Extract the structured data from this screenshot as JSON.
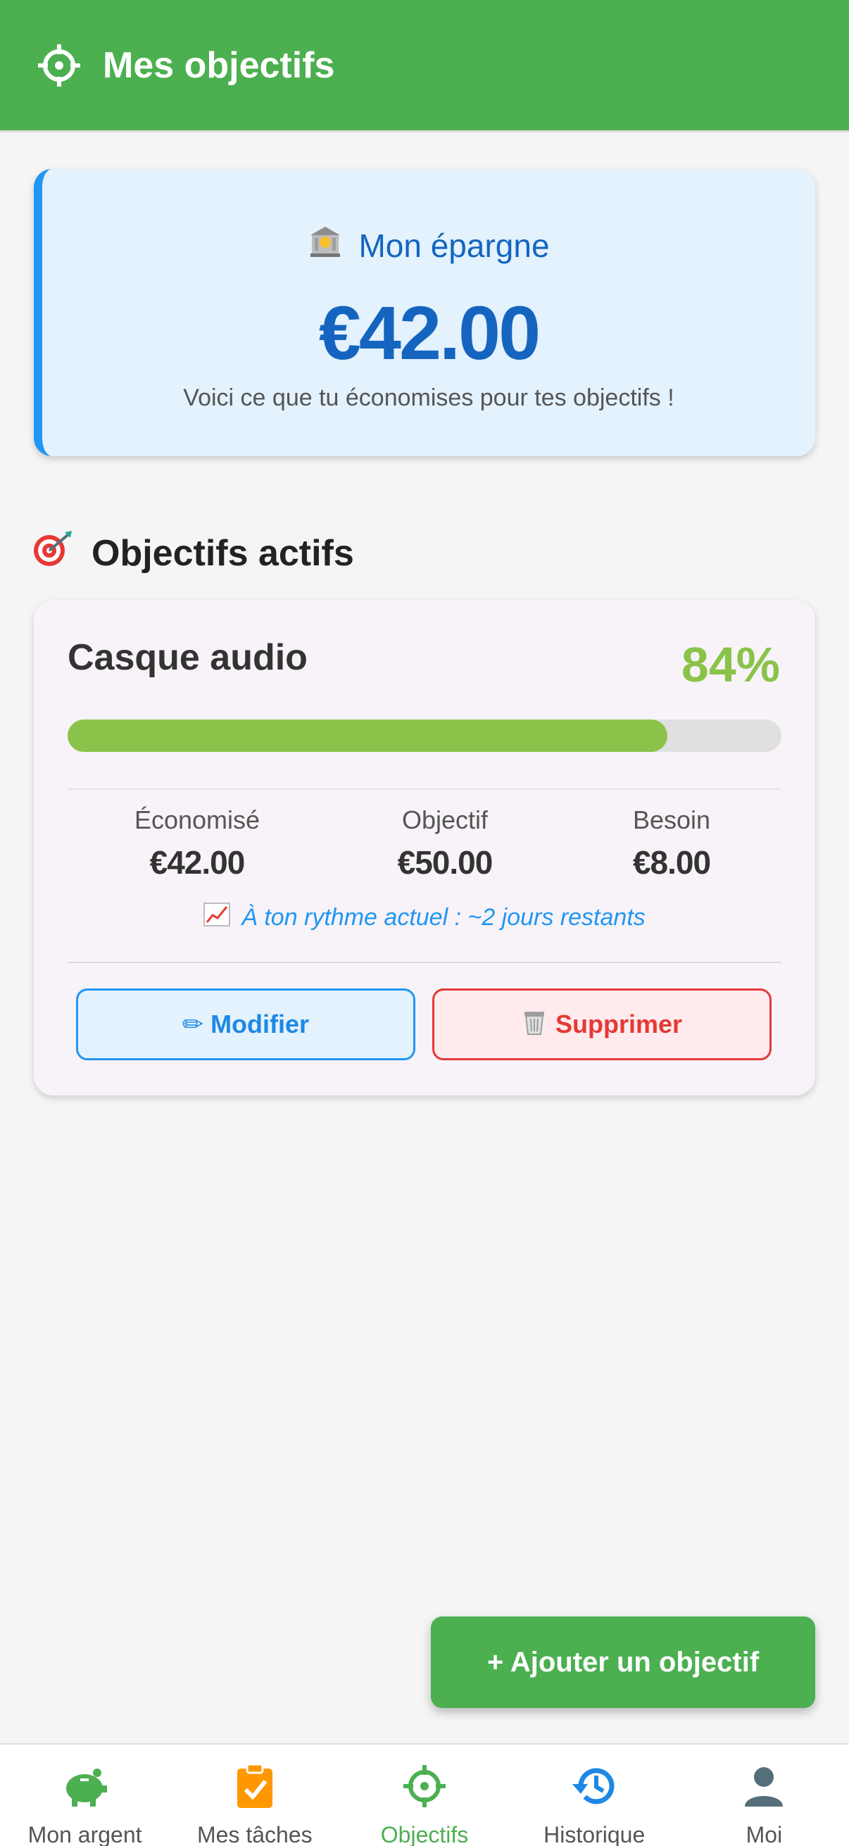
{
  "header": {
    "title": "Mes objectifs",
    "icon": "crosshair-icon"
  },
  "savings": {
    "title": "Mon épargne",
    "amount": "€42.00",
    "subtitle": "Voici ce que tu économises pour tes objectifs !"
  },
  "active_goals": {
    "title": "Objectifs actifs",
    "goals": [
      {
        "name": "Casque audio",
        "percent_label": "84%",
        "progress": 0.84,
        "saved_label": "Économisé",
        "saved_value": "€42.00",
        "target_label": "Objectif",
        "target_value": "€50.00",
        "need_label": "Besoin",
        "need_value": "€8.00",
        "rhythm": "À ton rythme actuel : ~2 jours restants",
        "edit_label": "✏ Modifier",
        "delete_label": "Supprimer"
      }
    ]
  },
  "fab": {
    "label": "+ Ajouter un objectif"
  },
  "nav": {
    "items": [
      {
        "label": "Mon argent",
        "icon": "piggy-bank-icon",
        "color": "#4caf50"
      },
      {
        "label": "Mes tâches",
        "icon": "clipboard-check-icon",
        "color": "#ff9800"
      },
      {
        "label": "Objectifs",
        "icon": "crosshair-icon",
        "color": "#4caf50",
        "active": true
      },
      {
        "label": "Historique",
        "icon": "history-icon",
        "color": "#1e88e5"
      },
      {
        "label": "Moi",
        "icon": "person-icon",
        "color": "#546e7a"
      }
    ]
  },
  "colors": {
    "primary": "#4caf50",
    "savings_blue": "#1565c0",
    "progress": "#8bc34a",
    "danger": "#e53935"
  }
}
